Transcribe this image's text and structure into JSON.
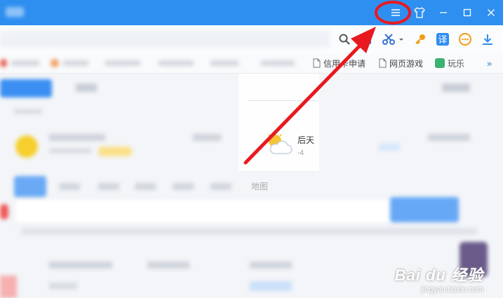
{
  "window": {
    "menu_icon": "hamburger-menu-icon",
    "skin_icon": "tshirt-skin-icon",
    "minimize_icon": "minimize-icon",
    "maximize_icon": "maximize-icon",
    "close_icon": "close-icon"
  },
  "bookmarks": [
    {
      "label": "信用卡申请",
      "icon": "page-icon"
    },
    {
      "label": "网页游戏",
      "icon": "page-icon"
    },
    {
      "label": "玩乐",
      "icon": "game-icon"
    }
  ],
  "weather": {
    "day": "后天",
    "temp": "-4"
  },
  "search_tabs": [
    "地图"
  ],
  "watermark": {
    "text": "Bai du 经验",
    "url": "jingyan.baidu.com"
  },
  "colors": {
    "titlebar": "#2e8ff0",
    "annotation": "#e8191f",
    "accent": "#2f8df0"
  }
}
